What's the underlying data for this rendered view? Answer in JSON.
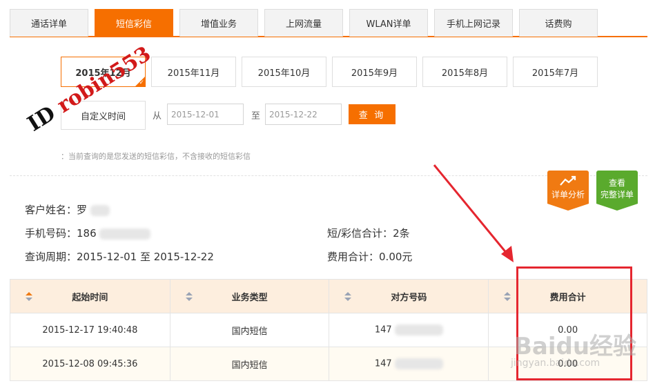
{
  "tabs": [
    "通话详单",
    "短信彩信",
    "增值业务",
    "上网流量",
    "WLAN详单",
    "手机上网记录",
    "话费购"
  ],
  "active_tab": "短信彩信",
  "months": [
    "2015年12月",
    "2015年11月",
    "2015年10月",
    "2015年9月",
    "2015年8月",
    "2015年7月"
  ],
  "custom_range": {
    "label": "自定义时间",
    "from_label": "从",
    "from_value": "2015-12-01",
    "to_label": "至",
    "to_value": "2015-12-22",
    "query_button": "查 询"
  },
  "tip": "：当前查询的是您发送的短信彩信，不含接收的短信彩信",
  "badges": {
    "analysis": "详单分析",
    "full_line1": "查看",
    "full_line2": "完整详单"
  },
  "info": {
    "name_label": "客户姓名：",
    "name_value": "罗",
    "phone_label": "手机号码：",
    "phone_value": "186",
    "period_label": "查询周期：",
    "period_value": "2015-12-01 至 2015-12-22",
    "count_label": "短/彩信合计：",
    "count_value": "2条",
    "fee_label": "费用合计：",
    "fee_value": "0.00元"
  },
  "table": {
    "headers": [
      "起始时间",
      "业务类型",
      "对方号码",
      "费用合计"
    ],
    "rows": [
      {
        "time": "2015-12-17 19:40:48",
        "type": "国内短信",
        "number": "147",
        "fee": "0.00"
      },
      {
        "time": "2015-12-08 09:45:36",
        "type": "国内短信",
        "number": "147",
        "fee": "0.00"
      }
    ]
  },
  "watermark": {
    "id_prefix": "ID ",
    "id_name": "robin553",
    "baidu_text": "Baidu经验",
    "baidu_url": "jingyan.baidu.com"
  },
  "colors": {
    "accent": "#f66f00",
    "badge_green": "#5aaa2d",
    "annotation_red": "#e5262f"
  }
}
